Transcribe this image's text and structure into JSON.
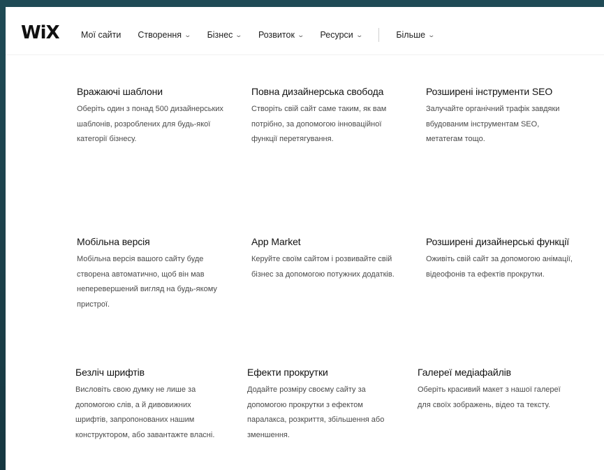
{
  "header": {
    "logo": "WiX",
    "nav": [
      {
        "label": "Мої сайти",
        "has_dropdown": false
      },
      {
        "label": "Створення",
        "has_dropdown": true
      },
      {
        "label": "Бізнес",
        "has_dropdown": true
      },
      {
        "label": "Розвиток",
        "has_dropdown": true
      },
      {
        "label": "Ресурси",
        "has_dropdown": true
      }
    ],
    "more": {
      "label": "Більше",
      "has_dropdown": true
    }
  },
  "features": [
    {
      "title": "Вражаючі шаблони",
      "lines": [
        "Оберіть один з понад 500 дизайнерських",
        "шаблонів, розроблених для будь-якої",
        "категорії бізнесу."
      ]
    },
    {
      "title": "Повна дизайнерська свобода",
      "lines": [
        "Створіть свій сайт саме таким, як вам",
        "потрібно, за допомогою інноваційної",
        "функції перетягування."
      ]
    },
    {
      "title": "Розширені інструменти SEO",
      "lines": [
        "Залучайте органічний трафік завдяки",
        "вбудованим інструментам SEO,",
        "метатегам тощо."
      ]
    },
    {
      "title": "Мобільна версія",
      "lines": [
        "Мобільна версія вашого сайту буде",
        "створена автоматично, щоб він мав",
        "неперевершений вигляд на будь-якому",
        "пристрої."
      ]
    },
    {
      "title": "App Market",
      "lines": [
        "Керуйте своїм сайтом і розвивайте свій",
        "бізнес за допомогою потужних додатків."
      ]
    },
    {
      "title": "Розширені дизайнерські функції",
      "lines": [
        "Оживіть свій сайт за допомогою анімації,",
        "відеофонів та ефектів прокрутки."
      ]
    },
    {
      "title": "Безліч шрифтів",
      "lines": [
        "Висловіть свою думку не лише за",
        "допомогою слів, а й дивовижних",
        "шрифтів, запропонованих нашим",
        "конструктором, або завантажте власні."
      ]
    },
    {
      "title": "Ефекти прокрутки",
      "lines": [
        "Додайте розміру своєму сайту за",
        "допомогою прокрутки з ефектом",
        "паралакса, розкриття, збільшення або",
        "зменшення."
      ]
    },
    {
      "title": "Галереї медіафайлів",
      "lines": [
        "Оберіть красивий макет з нашої галереї",
        "для своїх зображень, відео та тексту."
      ]
    }
  ]
}
